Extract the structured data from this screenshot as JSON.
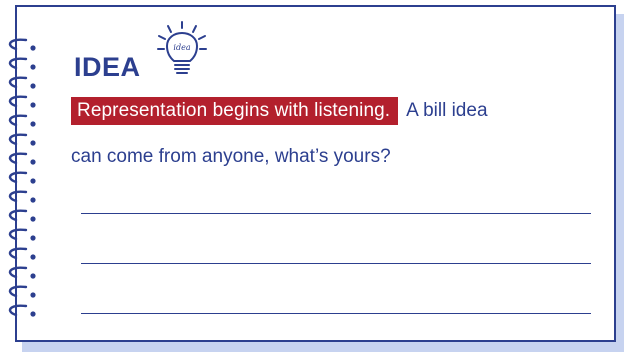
{
  "card": {
    "title": "IDEA",
    "bulb_text": "idea",
    "highlight": "Representation begins with listening.",
    "line1_rest": "A bill idea",
    "line2": "can come from anyone, what’s yours?"
  },
  "icons": {
    "bulb": "lightbulb-icon",
    "spiral": "spiral-binding-icon"
  },
  "colors": {
    "ink": "#2c3f8f",
    "highlight": "#b3202d",
    "shadow": "#c7d3f0"
  },
  "writing_lines": 3
}
